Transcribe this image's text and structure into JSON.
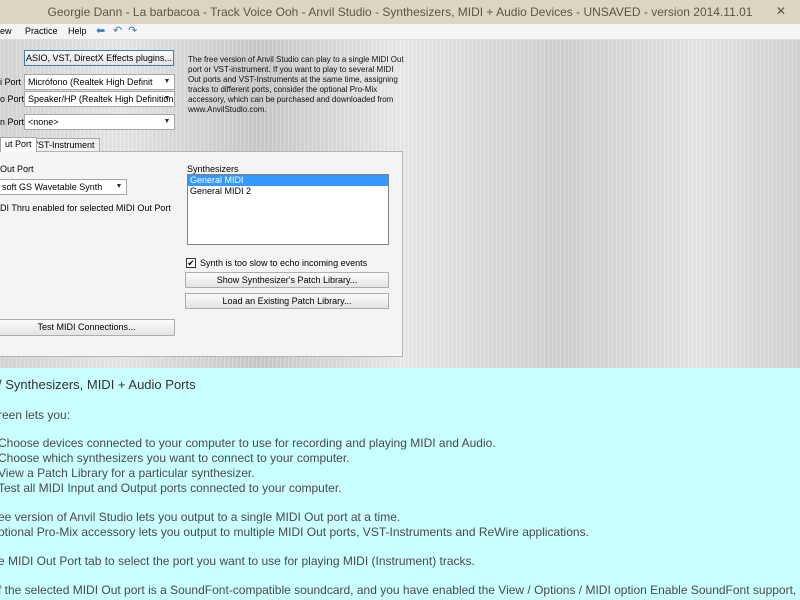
{
  "window": {
    "title": "Georgie Dann - La barbacoa - Track Voice Ooh - Anvil Studio - Synthesizers, MIDI + Audio Devices - UNSAVED - version 2014.11.01",
    "close_glyph": "✕"
  },
  "menu": {
    "items": [
      "ew",
      "Practice",
      "Help"
    ],
    "toolbar_icons": [
      "back-arrow-icon",
      "undo-icon",
      "redo-icon"
    ]
  },
  "top": {
    "asio_button": "ASIO, VST, DirectX Effects plugins...",
    "rows": [
      {
        "label": "i Port",
        "value": "Micrófono (Realtek High Definit"
      },
      {
        "label": "o Port",
        "value": "Speaker/HP (Realtek High Definition ."
      },
      {
        "label": "n Port",
        "value": "<none>"
      }
    ],
    "info_text": "The free version of Anvil Studio can play to a single MIDI Out port or VST-instrument.  If you want to play to several MIDI Out ports and VST-Instruments at the same time, assigning tracks to different ports, consider the optional Pro-Mix accessory, which can be purchased and downloaded from www.AnvilStudio.com."
  },
  "tabs": [
    {
      "label": "ut Port",
      "active": true
    },
    {
      "label": "VST-Instrument",
      "active": false
    }
  ],
  "panel": {
    "out_port_label": "Out Port",
    "out_port_value": "soft GS Wavetable Synth",
    "midi_thru_text": "DI Thru enabled for selected MIDI Out Port",
    "synth_label": "Synthesizers",
    "synths": [
      {
        "name": "General MIDI",
        "selected": true
      },
      {
        "name": "General MIDI 2",
        "selected": false
      }
    ],
    "echo_checkbox_label": "Synth is too slow to echo incoming events",
    "echo_checked": true,
    "check_glyph": "✔",
    "show_patch_button": "Show Synthesizer's Patch Library...",
    "load_patch_button": "Load an Existing Patch Library...",
    "test_button": "Test MIDI Connections..."
  },
  "help": {
    "heading": "/ Synthesizers, MIDI + Audio Ports",
    "intro": "reen lets you:",
    "bullets": [
      "Choose devices connected to your computer to use for recording and playing MIDI and Audio.",
      "Choose which synthesizers you want to connect to your computer.",
      "View a Patch Library for a particular synthesizer.",
      "Test all MIDI Input and Output ports connected to your computer."
    ],
    "para1_line1": "ee version of Anvil Studio lets you output to a single MIDI Out port at a time.",
    "para1_line2": "ptional Pro-Mix accessory lets you output to multiple MIDI Out ports, VST-Instruments and ReWire applications.",
    "para2": "e MIDI Out Port tab to select the port you want to use for playing MIDI (Instrument) tracks.",
    "para3": "f the selected MIDI Out port is a SoundFont-compatible soundcard, and you have enabled the View / Options / MIDI option Enable SoundFont support, the Load"
  }
}
